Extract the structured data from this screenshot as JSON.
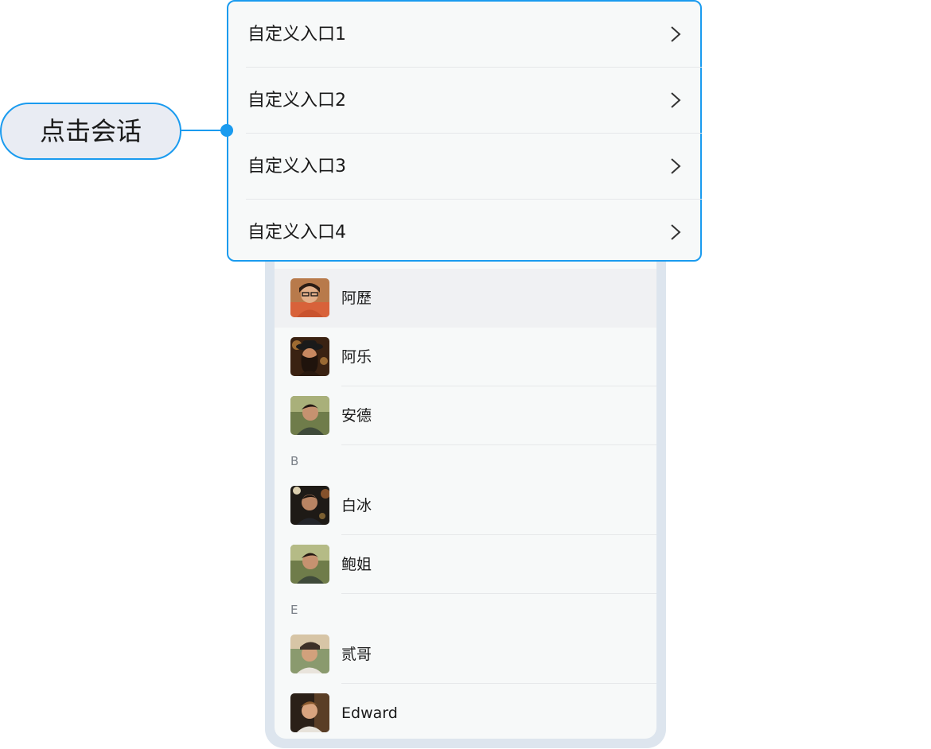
{
  "callout": {
    "label": "点击会话"
  },
  "popup_menu": {
    "items": [
      {
        "label": "自定义入口1",
        "icon": "chevron-right-icon"
      },
      {
        "label": "自定义入口2",
        "icon": "chevron-right-icon"
      },
      {
        "label": "自定义入口3",
        "icon": "chevron-right-icon"
      },
      {
        "label": "自定义入口4",
        "icon": "chevron-right-icon"
      }
    ]
  },
  "contacts": {
    "groups": [
      {
        "header": "",
        "items": [
          {
            "name": "阿歷",
            "selected": true
          },
          {
            "name": "阿乐"
          },
          {
            "name": "安德"
          }
        ]
      },
      {
        "header": "B",
        "items": [
          {
            "name": "白冰"
          },
          {
            "name": "鲍姐"
          }
        ]
      },
      {
        "header": "E",
        "items": [
          {
            "name": "贰哥"
          },
          {
            "name": "Edward"
          }
        ]
      }
    ]
  },
  "colors": {
    "accent": "#1a9bef",
    "callout_bg": "#e9ecf3",
    "frame": "#dde5ee",
    "screen_bg": "#f7f9f9",
    "selected_row": "#f0f1f3"
  }
}
